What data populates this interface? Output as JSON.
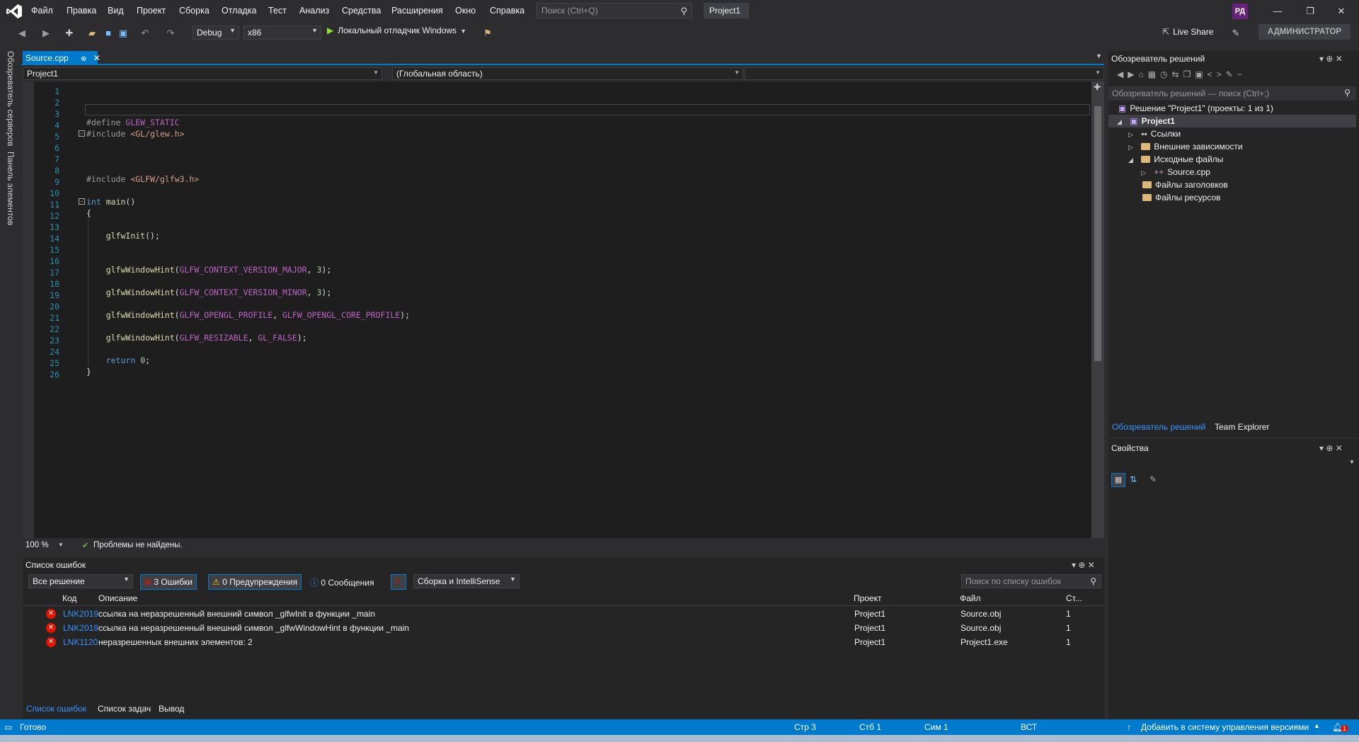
{
  "menu": [
    "Файл",
    "Правка",
    "Вид",
    "Проект",
    "Сборка",
    "Отладка",
    "Тест",
    "Анализ",
    "Средства",
    "Расширения",
    "Окно",
    "Справка"
  ],
  "search": {
    "placeholder": "Поиск (Ctrl+Q)"
  },
  "title_project": "Project1",
  "avatar": "РД",
  "toolbar": {
    "config": "Debug",
    "platform": "x86",
    "run_label": "Локальный отладчик Windows",
    "live_share": "Live Share",
    "admin": "АДМИНИСТРАТОР"
  },
  "left_strip": [
    "Обозреватель серверов",
    "Панель элементов"
  ],
  "editor": {
    "tab": "Source.cpp",
    "nav_project": "Project1",
    "nav_scope": "(Глобальная область)",
    "zoom": "100 %",
    "problems": "Проблемы не найдены.",
    "lines": [
      "",
      "",
      "",
      "#define GLEW_STATIC",
      "#include <GL/glew.h>",
      "",
      "",
      "",
      "#include <GLFW/glfw3.h>",
      "",
      "int main()",
      "{",
      "",
      "    glfwInit();",
      "",
      "",
      "    glfwWindowHint(GLFW_CONTEXT_VERSION_MAJOR, 3);",
      "",
      "    glfwWindowHint(GLFW_CONTEXT_VERSION_MINOR, 3);",
      "",
      "    glfwWindowHint(GLFW_OPENGL_PROFILE, GLFW_OPENGL_CORE_PROFILE);",
      "",
      "    glfwWindowHint(GLFW_RESIZABLE, GL_FALSE);",
      "",
      "    return 0;",
      "}"
    ]
  },
  "errors": {
    "title": "Список ошибок",
    "scope": "Все решение",
    "errors_btn": "3 Ошибки",
    "warnings_btn": "0 Предупреждения",
    "messages_btn": "0 Сообщения",
    "source": "Сборка и IntelliSense",
    "search_placeholder": "Поиск по списку ошибок",
    "columns": {
      "code": "Код",
      "desc": "Описание",
      "project": "Проект",
      "file": "Файл",
      "line": "Ст..."
    },
    "rows": [
      {
        "code": "LNK2019",
        "desc": "ссылка на неразрешенный внешний символ _glfwInit в функции _main",
        "project": "Project1",
        "file": "Source.obj",
        "line": "1"
      },
      {
        "code": "LNK2019",
        "desc": "ссылка на неразрешенный внешний символ _glfwWindowHint в функции _main",
        "project": "Project1",
        "file": "Source.obj",
        "line": "1"
      },
      {
        "code": "LNK1120",
        "desc": "неразрешенных внешних элементов: 2",
        "project": "Project1",
        "file": "Project1.exe",
        "line": "1"
      }
    ],
    "tabs": [
      "Список ошибок",
      "Список задач",
      "Вывод"
    ]
  },
  "solution": {
    "title": "Обозреватель решений",
    "search_placeholder": "Обозреватель решений — поиск (Ctrl+;)",
    "root": "Решение \"Project1\" (проекты: 1 из 1)",
    "project": "Project1",
    "refs": "Ссылки",
    "ext": "Внешние зависимости",
    "src": "Исходные файлы",
    "source_file": "Source.cpp",
    "headers": "Файлы заголовков",
    "resources": "Файлы ресурсов",
    "tab1": "Обозреватель решений",
    "tab2": "Team Explorer"
  },
  "properties": {
    "title": "Свойства"
  },
  "status": {
    "ready": "Готово",
    "line": "Стр 3",
    "col": "Стб 1",
    "ch": "Сим 1",
    "ins": "ВСТ",
    "vcs": "Добавить в систему управления версиями",
    "notif": "1"
  }
}
